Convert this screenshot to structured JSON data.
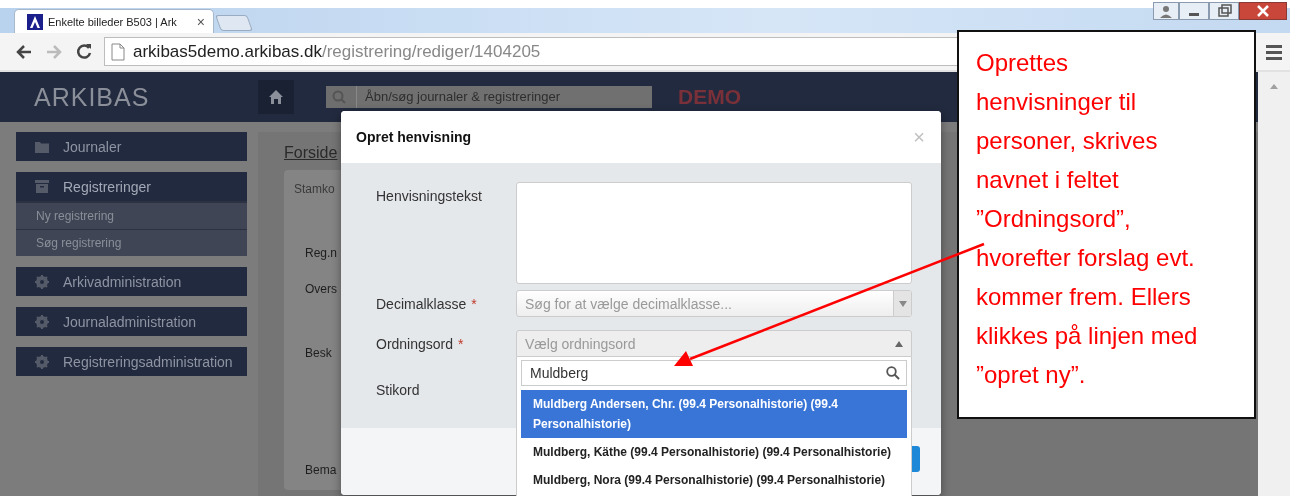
{
  "browser": {
    "tab_title": "Enkelte billeder B503 | Ark",
    "close": "×",
    "url_host": "arkibas5demo.arkibas.dk",
    "url_path": "/registrering/rediger/1404205"
  },
  "header": {
    "logo": "ARKIBAS",
    "search_placeholder": "Åbn/søg journaler & registreringer",
    "env_label": "DEMO"
  },
  "sidebar": {
    "items": [
      {
        "label": "Journaler",
        "expanded": false
      },
      {
        "label": "Registreringer",
        "expanded": true,
        "children": [
          {
            "label": "Ny registrering"
          },
          {
            "label": "Søg registrering"
          }
        ]
      },
      {
        "label": "Arkivadministration",
        "expanded": false
      },
      {
        "label": "Journaladministration",
        "expanded": false
      },
      {
        "label": "Registreringsadministration",
        "expanded": false
      }
    ]
  },
  "main": {
    "breadcrumb": "Forside",
    "tab": "Stamko",
    "labels": [
      "Reg.n",
      "Overs",
      "Besk",
      "Bema"
    ]
  },
  "modal": {
    "title": "Opret henvisning",
    "close": "×",
    "fields": [
      {
        "label": "Henvisningstekst",
        "kind": "textarea"
      },
      {
        "label": "Decimalklasse",
        "mark": "*",
        "kind": "select",
        "placeholder": "Søg for at vælge decimalklasse..."
      },
      {
        "label": "Ordningsord",
        "mark": "*",
        "kind": "select",
        "placeholder": "Vælg ordningsord",
        "expanded": true
      },
      {
        "label": "Stikord",
        "kind": "tags"
      }
    ],
    "dropdown": {
      "search_value": "Muldberg",
      "options": [
        {
          "label": "Muldberg Andersen, Chr. (99.4 Personalhistorie) (99.4 Personalhistorie)",
          "selected": true
        },
        {
          "label": "Muldberg, Käthe (99.4 Personalhistorie) (99.4 Personalhistorie)",
          "selected": false
        },
        {
          "label": "Muldberg, Nora (99.4 Personalhistorie) (99.4 Personalhistorie)",
          "selected": false
        }
      ]
    }
  },
  "callout": {
    "lines": [
      "Oprettes",
      "henvisninger til",
      "personer, skrives",
      "navnet i feltet",
      "”Ordningsord”,",
      "hvorefter forslag evt.",
      "kommer frem. Ellers",
      "klikkes på linjen med",
      "”opret ny”."
    ]
  }
}
